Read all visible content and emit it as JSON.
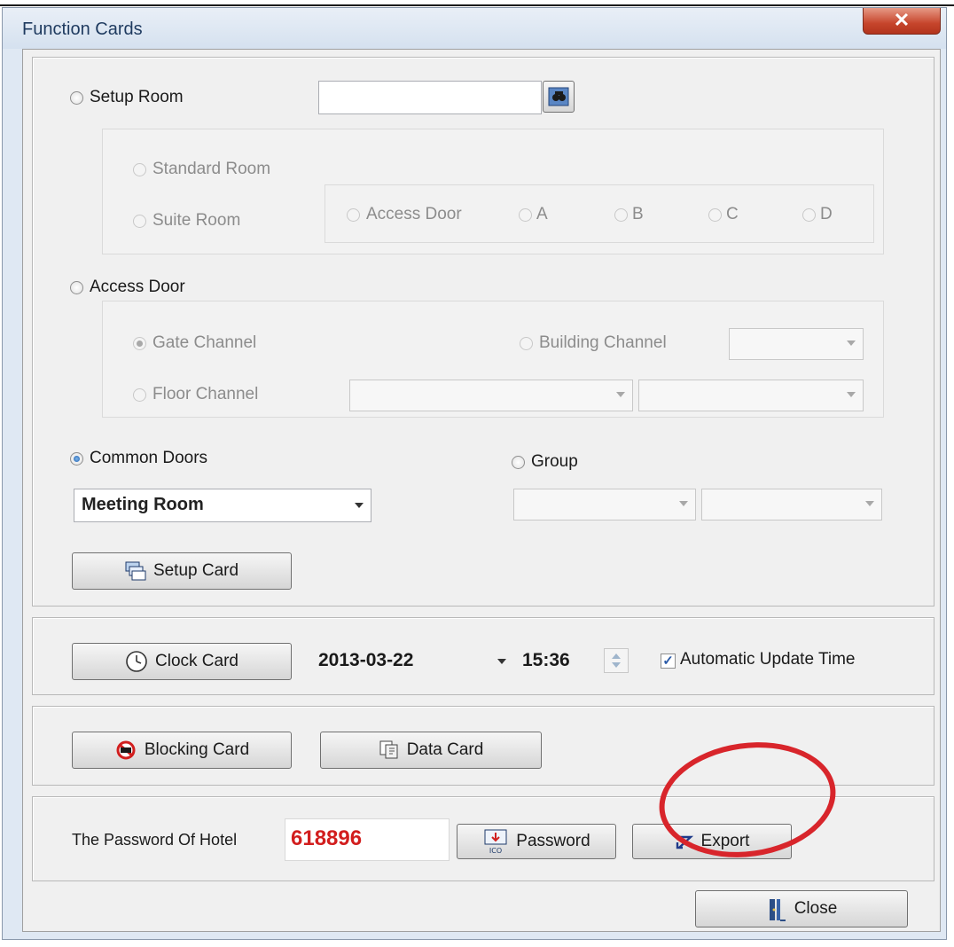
{
  "window": {
    "title": "Function Cards",
    "close_glyph": "✕"
  },
  "setup_room": {
    "label": "Setup Room",
    "room_input_value": "",
    "standard_room": "Standard Room",
    "suite_room": "Suite Room",
    "access_door": "Access Door",
    "doors": [
      "A",
      "B",
      "C",
      "D"
    ]
  },
  "access_door": {
    "label": "Access Door",
    "gate_channel": "Gate Channel",
    "building_channel": "Building Channel",
    "floor_channel": "Floor Channel"
  },
  "common_doors": {
    "label": "Common Doors",
    "selected": "Meeting Room",
    "group_label": "Group",
    "setup_card_button": "Setup Card"
  },
  "clock": {
    "button": "Clock Card",
    "date": "2013-03-22",
    "time": "15:36",
    "auto_update_label": "Automatic Update Time",
    "auto_update_checked": true
  },
  "cards": {
    "blocking": "Blocking Card",
    "data": "Data Card"
  },
  "password": {
    "label": "The Password Of Hotel",
    "value": "618896",
    "password_button": "Password",
    "export_button": "Export",
    "ico_text": "ICO"
  },
  "close_button": "Close",
  "colors": {
    "password_red": "#d21e1e",
    "highlight_circle": "#d8252b",
    "radio_selected": "#1e5fae"
  },
  "icons": [
    "search-icon",
    "setup-card-icon",
    "clock-icon",
    "blocking-icon",
    "data-card-icon",
    "password-icon",
    "export-icon",
    "close-door-icon"
  ]
}
